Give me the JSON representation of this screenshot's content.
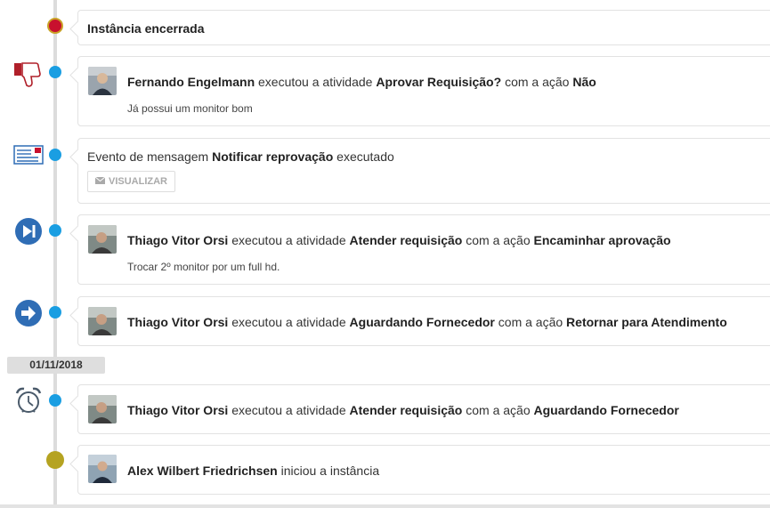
{
  "timeline": {
    "date_badge": "01/11/2018",
    "events": [
      {
        "title": "Instância encerrada"
      },
      {
        "user": "Fernando Engelmann",
        "verb": "executou a atividade",
        "activity": "Aprovar Requisição?",
        "with_action": "com a ação",
        "action": "Não",
        "comment": "Já possui um monitor bom"
      },
      {
        "prefix": "Evento de mensagem",
        "event_name": "Notificar reprovação",
        "suffix": "executado",
        "button_label": "VISUALIZAR"
      },
      {
        "user": "Thiago Vitor Orsi",
        "verb": "executou a atividade",
        "activity": "Atender requisição",
        "with_action": "com a ação",
        "action": "Encaminhar aprovação",
        "comment": "Trocar 2º monitor por um full hd."
      },
      {
        "user": "Thiago Vitor Orsi",
        "verb": "executou a atividade",
        "activity": "Aguardando Fornecedor",
        "with_action": "com a ação",
        "action": "Retornar para Atendimento"
      },
      {
        "user": "Thiago Vitor Orsi",
        "verb": "executou a atividade",
        "activity": "Atender requisição",
        "with_action": "com a ação",
        "action": "Aguardando Fornecedor"
      },
      {
        "user": "Alex Wilbert Friedrichsen",
        "verb": "iniciou a instância"
      }
    ]
  },
  "colors": {
    "timeline_dot": "#1a9ee2",
    "end_dot": "#c8102e",
    "start_dot": "#b5a321",
    "icon_blue": "#2f6db5",
    "thumbs_down_red": "#b0202a"
  },
  "icons": {
    "thumbs_down": "thumbs-down-icon",
    "message": "envelope-letter-icon",
    "forward": "skip-forward-icon",
    "return": "arrow-right-circle-icon",
    "timer": "alarm-clock-icon",
    "button": "envelope-icon"
  }
}
